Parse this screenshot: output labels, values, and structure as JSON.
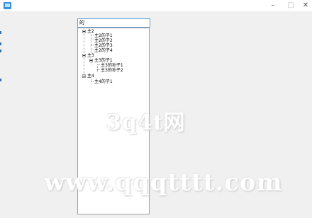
{
  "window": {
    "controls": {
      "minimize": "–",
      "maximize": "□",
      "close": "✕"
    }
  },
  "search": {
    "value": "的"
  },
  "tree": {
    "nodes": [
      {
        "label": "主2",
        "children": [
          "主2的子1",
          "主2的子2",
          "主2的子3",
          "主2的子4"
        ]
      },
      {
        "label": "主3",
        "children": [
          {
            "label": "主3的子1",
            "children": [
              "主3的孙子1",
              "主3的孙子2"
            ]
          }
        ]
      },
      {
        "label": "主4",
        "children": [
          "主4的子1"
        ]
      }
    ]
  },
  "watermark": {
    "line1": "3q4t网",
    "line2": "www.qqqtttt.com"
  }
}
